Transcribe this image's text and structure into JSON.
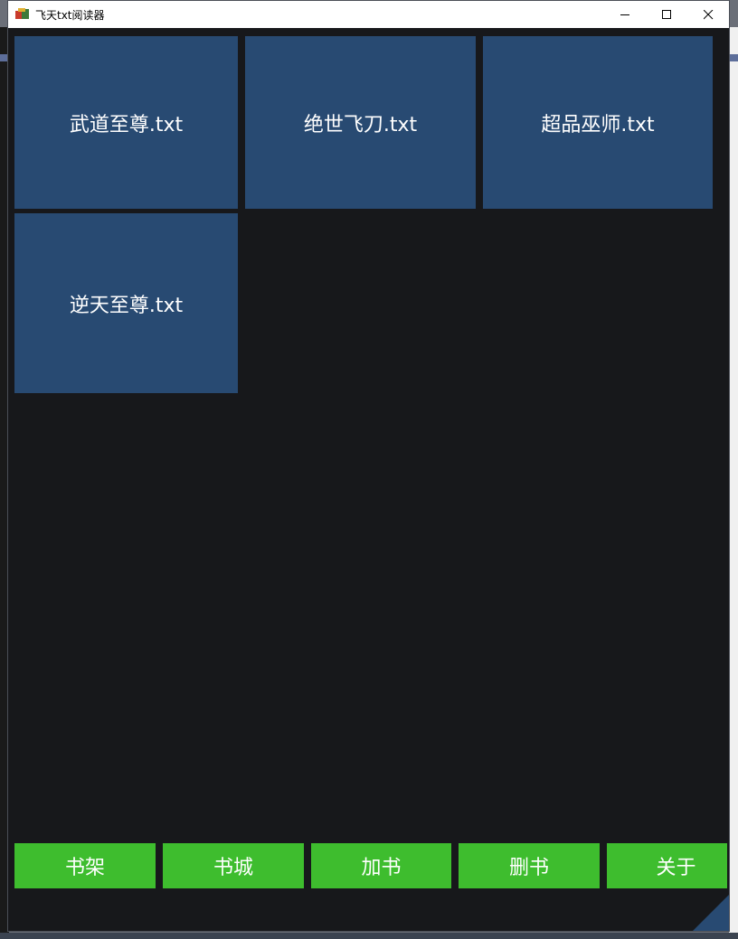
{
  "window": {
    "title": "飞天txt阅读器",
    "controls": [
      "minimize",
      "maximize",
      "close"
    ]
  },
  "books": [
    {
      "name": "武道至尊.txt"
    },
    {
      "name": "绝世飞刀.txt"
    },
    {
      "name": "超品巫师.txt"
    },
    {
      "name": "逆天至尊.txt"
    }
  ],
  "nav": {
    "bookshelf": "书架",
    "bookstore": "书城",
    "add_book": "加书",
    "delete_book": "删书",
    "about": "关于"
  },
  "colors": {
    "background": "#17181b",
    "tile": "#284a72",
    "nav_button": "#3ebd2e",
    "text": "#ffffff"
  }
}
